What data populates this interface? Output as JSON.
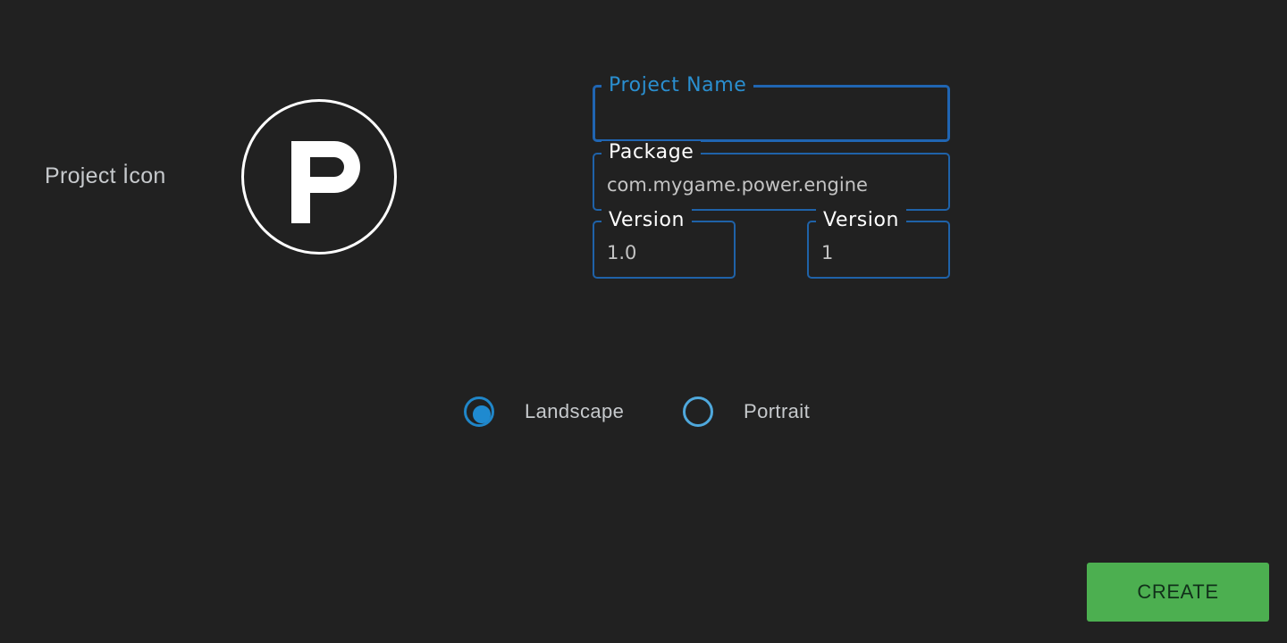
{
  "project_icon": {
    "label": "Project İcon",
    "icon": "power-engine-logo-icon"
  },
  "form": {
    "project_name": {
      "label": "Project Name",
      "value": "",
      "focused": true
    },
    "package": {
      "label": "Package",
      "value": "com.mygame.power.engine"
    },
    "version_name": {
      "label": "Version",
      "value": "1.0"
    },
    "version_code": {
      "label": "Version",
      "value": "1"
    }
  },
  "orientation": {
    "options": [
      {
        "label": "Landscape",
        "checked": true
      },
      {
        "label": "Portrait",
        "checked": false
      }
    ]
  },
  "actions": {
    "create_label": "CREATE"
  },
  "colors": {
    "background": "#212121",
    "field_border": "#1f62a8",
    "focus_label": "#2a8fd0",
    "radio_accent": "#1f8ad0",
    "create_button": "#4caf50"
  }
}
